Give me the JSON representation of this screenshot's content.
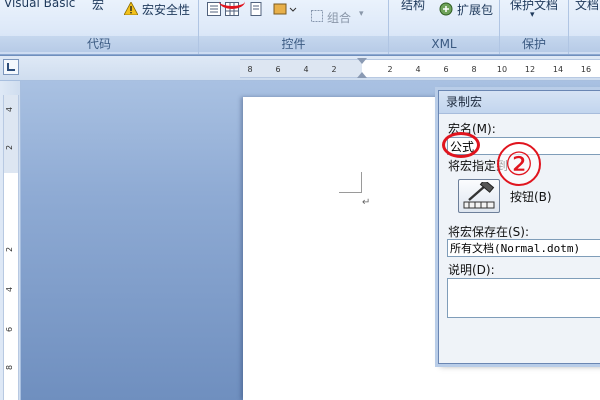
{
  "ribbon": {
    "groups": {
      "code": {
        "label": "代码",
        "visual_basic": "Visual Basic",
        "macro": "宏",
        "macro_security": "宏安全性"
      },
      "controls": {
        "label": "控件",
        "combine": "组合"
      },
      "xml": {
        "label": "XML",
        "structure": "结构",
        "expansion_pack": "扩展包"
      },
      "protect": {
        "label": "保护",
        "protect_doc": "保护文档"
      },
      "extra": {
        "label": "文档"
      }
    }
  },
  "ruler": {
    "left_numbers": [
      "8",
      "6",
      "4",
      "2"
    ],
    "right_numbers": [
      "2",
      "4",
      "6",
      "8",
      "10",
      "12",
      "14",
      "16"
    ],
    "vertical_numbers": [
      "4",
      "2",
      "2",
      "4",
      "6",
      "8"
    ]
  },
  "dialog": {
    "title": "录制宏",
    "macro_name_label": "宏名(M):",
    "macro_name_value": "公式",
    "assign_to_label": "将宏指定到",
    "button_label": "按钮(B)",
    "store_in_label": "将宏保存在(S):",
    "store_in_value": "所有文档(Normal.dotm)",
    "description_label": "说明(D):"
  },
  "annotation": {
    "step_number": "②"
  },
  "colors": {
    "annotation_red": "#e0141e",
    "ribbon_bg": "#dce8f8",
    "workspace_blue": "#8fabd4"
  }
}
